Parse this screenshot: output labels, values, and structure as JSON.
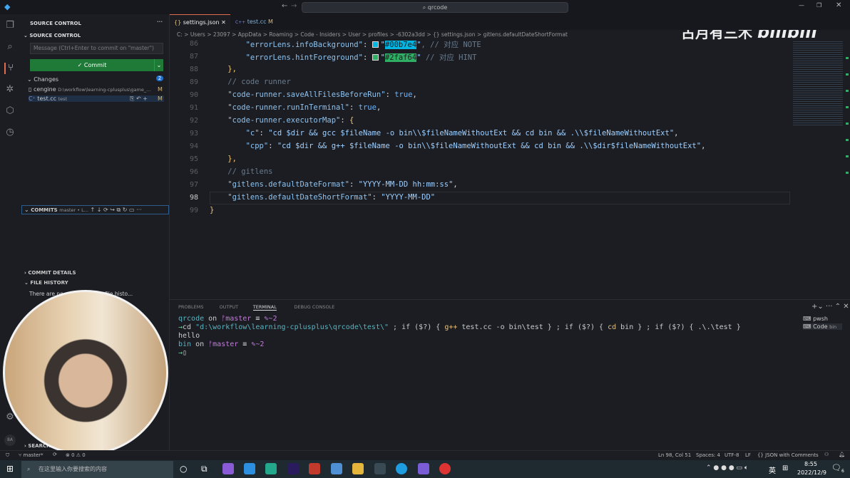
{
  "title": {
    "search": "qrcode"
  },
  "watermark": {
    "channel": "古月有三木",
    "brand": "bilibili"
  },
  "sidebar": {
    "header": "SOURCE CONTROL",
    "section": "SOURCE CONTROL",
    "message_placeholder": "Message (Ctrl+Enter to commit on \"master\")",
    "commit_label": "✓ Commit",
    "changes_label": "Changes",
    "changes_count": "2",
    "files": [
      {
        "name": "cengine",
        "path": "D:\\workflow\\learning-cplusplus\\game_...",
        "status": "M"
      },
      {
        "name": "test.cc",
        "path": "test",
        "status": "M"
      }
    ],
    "commits_label": "COMMITS",
    "commits_branch": "master • L...",
    "commit_details": "COMMIT DETAILS",
    "file_history": "FILE HISTORY",
    "file_history_text": "There are no ... can provide file histo...",
    "search_label": "SEARCH",
    "badge": "8A"
  },
  "tabs": [
    {
      "label": "settings.json",
      "icon": "{}",
      "active": true
    },
    {
      "label": "test.cc",
      "icon": "C++",
      "status": "M"
    }
  ],
  "breadcrumb": "C: > Users > 23097 > AppData > Roaming > Code - Insiders > User > profiles > -6302a3dd > {} settings.json > gitlens.defaultDateShortFormat",
  "colors": {
    "info": "#00b7e4",
    "hint": "#2faf64",
    "accent": "#1f7a37"
  },
  "code": [
    {
      "n": "86",
      "tokens": [
        {
          "t": "        "
        },
        {
          "t": "\"errorLens.infoBackground\"",
          "c": "k"
        },
        {
          "t": ": ",
          "c": "p"
        },
        {
          "t": "",
          "c": "sw1"
        },
        {
          "t": "\"",
          "c": "s"
        },
        {
          "t": "#00b7e4",
          "c": "hl1"
        },
        {
          "t": "\"",
          "c": "s"
        },
        {
          "t": ", // 对应 NOTE",
          "c": "c"
        }
      ]
    },
    {
      "n": "87",
      "tokens": [
        {
          "t": "        "
        },
        {
          "t": "\"errorLens.hintForeground\"",
          "c": "k"
        },
        {
          "t": ": ",
          "c": "p"
        },
        {
          "t": "",
          "c": "sw2"
        },
        {
          "t": "\"",
          "c": "s"
        },
        {
          "t": "#2faf64",
          "c": "hl2"
        },
        {
          "t": "\"",
          "c": "s"
        },
        {
          "t": " // 对应 HINT",
          "c": "c"
        }
      ]
    },
    {
      "n": "88",
      "tokens": [
        {
          "t": "    },",
          "c": "b"
        }
      ]
    },
    {
      "n": "89",
      "tokens": [
        {
          "t": "    // code runner",
          "c": "c"
        }
      ]
    },
    {
      "n": "90",
      "tokens": [
        {
          "t": "    "
        },
        {
          "t": "\"code-runner.saveAllFilesBeforeRun\"",
          "c": "k"
        },
        {
          "t": ": ",
          "c": "p"
        },
        {
          "t": "true",
          "c": "kw"
        },
        {
          "t": ",",
          "c": "p"
        }
      ]
    },
    {
      "n": "91",
      "tokens": [
        {
          "t": "    "
        },
        {
          "t": "\"code-runner.runInTerminal\"",
          "c": "k"
        },
        {
          "t": ": ",
          "c": "p"
        },
        {
          "t": "true",
          "c": "kw"
        },
        {
          "t": ",",
          "c": "p"
        }
      ]
    },
    {
      "n": "92",
      "tokens": [
        {
          "t": "    "
        },
        {
          "t": "\"code-runner.executorMap\"",
          "c": "k"
        },
        {
          "t": ": ",
          "c": "p"
        },
        {
          "t": "{",
          "c": "b"
        }
      ]
    },
    {
      "n": "93",
      "tokens": [
        {
          "t": "        "
        },
        {
          "t": "\"c\"",
          "c": "k"
        },
        {
          "t": ": ",
          "c": "p"
        },
        {
          "t": "\"cd $dir && gcc $fileName -o bin\\\\$fileNameWithoutExt && cd bin && .\\\\$fileNameWithoutExt\"",
          "c": "s"
        },
        {
          "t": ",",
          "c": "p"
        }
      ]
    },
    {
      "n": "94",
      "tokens": [
        {
          "t": "        "
        },
        {
          "t": "\"cpp\"",
          "c": "k"
        },
        {
          "t": ": ",
          "c": "p"
        },
        {
          "t": "\"cd $dir && g++ $fileName -o bin\\\\$fileNameWithoutExt && cd bin && .\\\\$dir$fileNameWithoutExt\"",
          "c": "s"
        },
        {
          "t": ",",
          "c": "p"
        }
      ]
    },
    {
      "n": "95",
      "tokens": [
        {
          "t": "    },",
          "c": "b"
        }
      ]
    },
    {
      "n": "96",
      "tokens": [
        {
          "t": "    // gitlens",
          "c": "c"
        }
      ]
    },
    {
      "n": "97",
      "tokens": [
        {
          "t": "    "
        },
        {
          "t": "\"gitlens.defaultDateFormat\"",
          "c": "k"
        },
        {
          "t": ": ",
          "c": "p"
        },
        {
          "t": "\"YYYY-MM-DD hh:mm:ss\"",
          "c": "s"
        },
        {
          "t": ",",
          "c": "p"
        }
      ]
    },
    {
      "n": "98",
      "tokens": [
        {
          "t": "    "
        },
        {
          "t": "\"gitlens.defaultDateShortFormat\"",
          "c": "k"
        },
        {
          "t": ": ",
          "c": "p"
        },
        {
          "t": "\"YYYY-MM-DD\"",
          "c": "s"
        }
      ]
    },
    {
      "n": "99",
      "tokens": [
        {
          "t": "}",
          "c": "b"
        }
      ]
    }
  ],
  "panel": {
    "tabs": [
      "PROBLEMS",
      "OUTPUT",
      "TERMINAL",
      "DEBUG CONSOLE"
    ],
    "active": "TERMINAL",
    "terminals": [
      {
        "label": "pwsh"
      },
      {
        "label": "Code",
        "sub": "bin"
      }
    ],
    "lines": [
      [
        {
          "t": "qrcode",
          "c": "cy"
        },
        {
          "t": " on "
        },
        {
          "t": "ᚠmaster",
          "c": "pu"
        },
        {
          "t": " ≡ "
        },
        {
          "t": "✎~2",
          "c": "pu"
        }
      ],
      [
        {
          "t": "→",
          "c": "gr"
        },
        {
          "t": "cd "
        },
        {
          "t": "\"d:\\workflow\\learning-cplusplus\\qrcode\\test\\\"",
          "c": "cy"
        },
        {
          "t": " ; if ($?) { "
        },
        {
          "t": "g++",
          "c": "ye"
        },
        {
          "t": " test.cc -o bin\\test } ; if ($?) { "
        },
        {
          "t": "cd",
          "c": "ye"
        },
        {
          "t": " bin } ; if ($?) { .\\.\\test }"
        }
      ],
      [
        {
          "t": "hello"
        }
      ],
      [
        {
          "t": "bin",
          "c": "cy"
        },
        {
          "t": " on "
        },
        {
          "t": "ᚠmaster",
          "c": "pu"
        },
        {
          "t": " ≡ "
        },
        {
          "t": "✎~2",
          "c": "pu"
        }
      ],
      [
        {
          "t": "→",
          "c": "gr"
        },
        {
          "t": "▯"
        }
      ]
    ]
  },
  "status": {
    "branch": "master*",
    "sync": "⟳",
    "errors": "⊗ 0 ⚠ 0",
    "position": "Ln 98, Col 51",
    "spaces": "Spaces: 4",
    "encoding": "UTF-8",
    "eol": "LF",
    "language": "{} JSON with Comments"
  },
  "taskbar": {
    "search_placeholder": "在这里输入你要搜索的内容",
    "ime": "英",
    "time": "8:55",
    "date": "2022/12/9",
    "notifications": "6"
  }
}
